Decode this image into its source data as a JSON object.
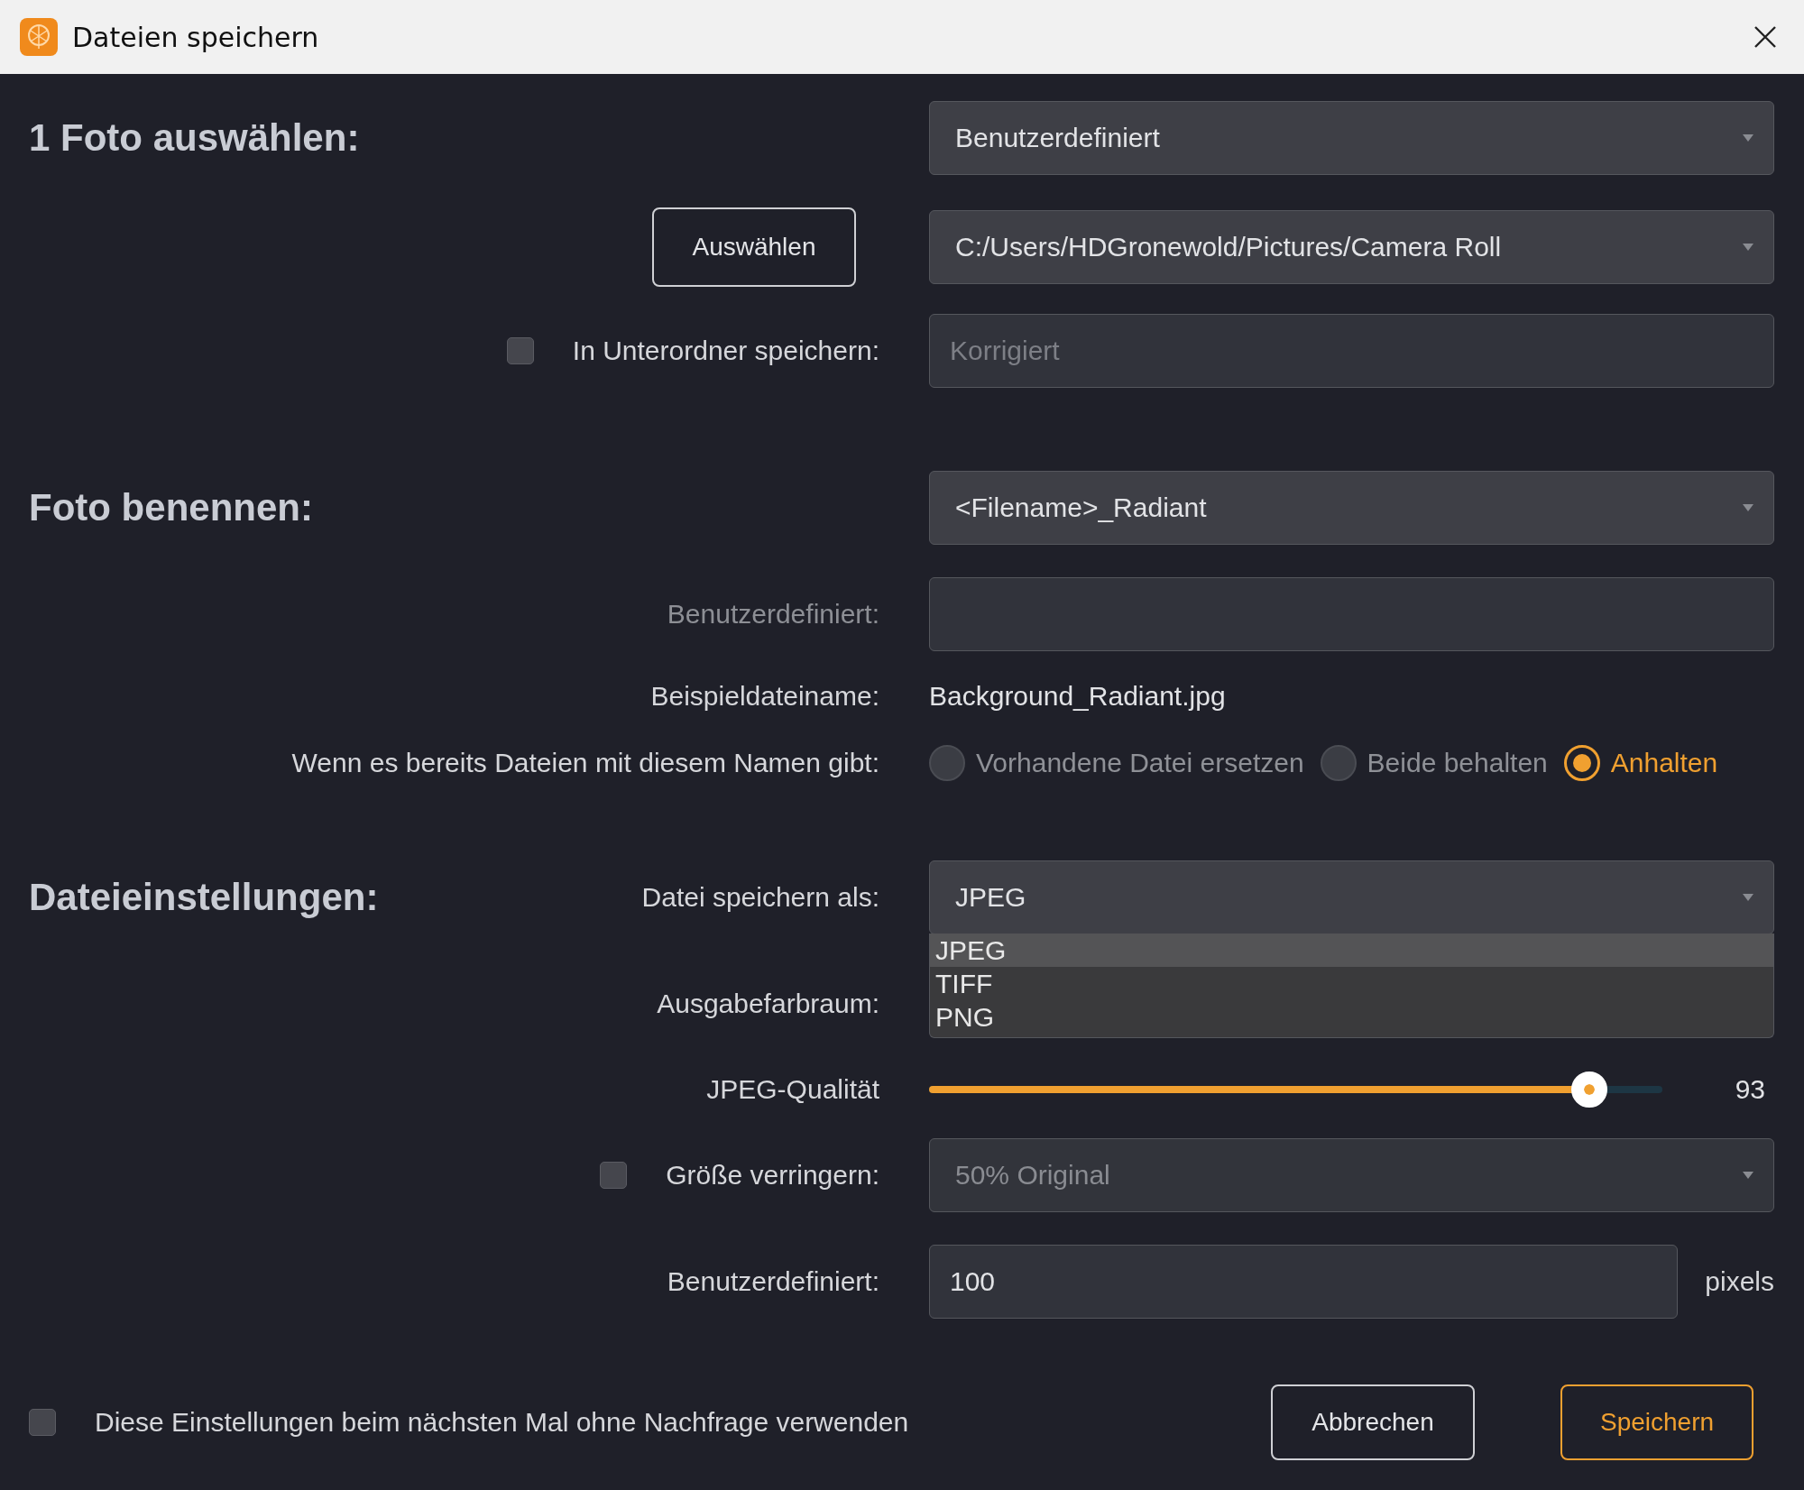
{
  "window": {
    "title": "Dateien speichern"
  },
  "rows": [
    {
      "kind": "select",
      "heading": "1 Foto auswählen:",
      "value": "Benutzerdefiniert",
      "disabled": false
    },
    {
      "kind": "select",
      "button": "Auswählen",
      "value": "C:/Users/HDGronewold/Pictures/Camera Roll",
      "disabled": false
    },
    {
      "kind": "input",
      "label": "In Unterordner speichern:",
      "checked": false,
      "placeholder": "Korrigiert"
    },
    {
      "kind": "select",
      "heading": "Foto benennen:",
      "value": "<Filename>_Radiant",
      "disabled": false
    },
    {
      "kind": "input",
      "label": "Benutzerdefiniert:",
      "label_disabled": true
    },
    {
      "kind": "text",
      "label": "Beispieldateiname:",
      "value": "Background_Radiant.jpg"
    },
    {
      "kind": "radios",
      "label": "Wenn es bereits Dateien mit diesem Namen gibt:",
      "options": [
        {
          "label": "Vorhandene Datei ersetzen",
          "selected": false
        },
        {
          "label": "Beide behalten",
          "selected": false
        },
        {
          "label": "Anhalten",
          "selected": true
        }
      ]
    },
    {
      "kind": "select",
      "heading": "Dateieinstellungen:",
      "label": "Datei speichern als:",
      "value": "JPEG",
      "disabled": false,
      "expanded": true,
      "options": [
        {
          "label": "JPEG",
          "selected": true
        },
        {
          "label": "TIFF",
          "selected": false
        },
        {
          "label": "PNG",
          "selected": false
        }
      ]
    },
    {
      "kind": "label",
      "label": "Ausgabefarbraum:"
    },
    {
      "kind": "slider",
      "label": "JPEG-Qualität",
      "level": 0.9,
      "reading": "93"
    },
    {
      "kind": "select",
      "label": "Größe verringern:",
      "checked": false,
      "value": "50% Original",
      "disabled": true
    },
    {
      "kind": "input",
      "label": "Benutzerdefiniert:",
      "value": "100",
      "unit": "pixels"
    }
  ],
  "footer": {
    "checkbox": {
      "label": "Diese Einstellungen beim nächsten Mal ohne Nachfrage verwenden",
      "checked": false
    },
    "buttons": [
      {
        "label": "Abbrechen",
        "kind": "secondary"
      },
      {
        "label": "Speichern",
        "kind": "primary"
      }
    ]
  }
}
